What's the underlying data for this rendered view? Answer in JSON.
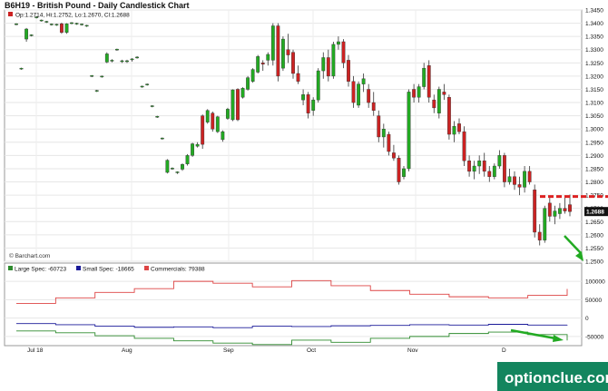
{
  "header": {
    "title": "B6H19 - British Pound - Daily Candlestick Chart"
  },
  "watermark": "optionclue.com",
  "chart_data": [
    {
      "type": "candlestick",
      "title": "B6H19 - British Pound - Daily Candlestick Chart",
      "ohlc_label": "Op:1.2714, Hi:1.2752, Lo:1.2670, Cl:1.2688",
      "last_price_label": "1.2688",
      "source": "© Barchart.com",
      "ylim": [
        1.25,
        1.345
      ],
      "y_ticks": [
        1.25,
        1.255,
        1.26,
        1.265,
        1.27,
        1.275,
        1.28,
        1.285,
        1.29,
        1.295,
        1.3,
        1.305,
        1.31,
        1.315,
        1.32,
        1.325,
        1.33,
        1.335,
        1.34,
        1.345
      ],
      "x_ticks": [
        "Jul 18",
        "Aug",
        "Sep",
        "Oct",
        "Nov",
        "D"
      ],
      "reference_level": 1.2745,
      "colors": {
        "up": "#22aa22",
        "down": "#cc2222",
        "reference": "#dd2222",
        "arrow": "#22aa22"
      },
      "candles": [
        {
          "o": 1.3396,
          "h": 1.34,
          "l": 1.3392,
          "c": 1.3398
        },
        {
          "o": 1.3228,
          "h": 1.3232,
          "l": 1.3224,
          "c": 1.323
        },
        {
          "o": 1.334,
          "h": 1.3382,
          "l": 1.333,
          "c": 1.3378
        },
        {
          "o": 1.3354,
          "h": 1.3358,
          "l": 1.335,
          "c": 1.3356
        },
        {
          "o": 1.3422,
          "h": 1.3426,
          "l": 1.3418,
          "c": 1.3424
        },
        {
          "o": 1.341,
          "h": 1.3414,
          "l": 1.3406,
          "c": 1.3412
        },
        {
          "o": 1.3405,
          "h": 1.3409,
          "l": 1.3401,
          "c": 1.3407
        },
        {
          "o": 1.3395,
          "h": 1.3399,
          "l": 1.3391,
          "c": 1.3397
        },
        {
          "o": 1.3394,
          "h": 1.3398,
          "l": 1.339,
          "c": 1.3396
        },
        {
          "o": 1.3398,
          "h": 1.3402,
          "l": 1.336,
          "c": 1.3365
        },
        {
          "o": 1.3365,
          "h": 1.34,
          "l": 1.336,
          "c": 1.3398
        },
        {
          "o": 1.34,
          "h": 1.3404,
          "l": 1.3396,
          "c": 1.3402
        },
        {
          "o": 1.3398,
          "h": 1.3402,
          "l": 1.3394,
          "c": 1.34
        },
        {
          "o": 1.3395,
          "h": 1.3399,
          "l": 1.3391,
          "c": 1.3397
        },
        {
          "o": 1.339,
          "h": 1.3394,
          "l": 1.3386,
          "c": 1.3392
        },
        {
          "o": 1.32,
          "h": 1.3204,
          "l": 1.3196,
          "c": 1.3202
        },
        {
          "o": 1.3144,
          "h": 1.3148,
          "l": 1.314,
          "c": 1.3146
        },
        {
          "o": 1.3198,
          "h": 1.3202,
          "l": 1.3194,
          "c": 1.32
        },
        {
          "o": 1.3253,
          "h": 1.329,
          "l": 1.3249,
          "c": 1.3284
        },
        {
          "o": 1.3258,
          "h": 1.3264,
          "l": 1.3252,
          "c": 1.326
        },
        {
          "o": 1.33,
          "h": 1.3304,
          "l": 1.3296,
          "c": 1.3302
        },
        {
          "o": 1.3255,
          "h": 1.3262,
          "l": 1.325,
          "c": 1.3258
        },
        {
          "o": 1.3255,
          "h": 1.3262,
          "l": 1.325,
          "c": 1.3258
        },
        {
          "o": 1.3262,
          "h": 1.3268,
          "l": 1.3255,
          "c": 1.3265
        },
        {
          "o": 1.327,
          "h": 1.3275,
          "l": 1.3266,
          "c": 1.3272
        },
        {
          "o": 1.316,
          "h": 1.3164,
          "l": 1.3156,
          "c": 1.3162
        },
        {
          "o": 1.3168,
          "h": 1.3172,
          "l": 1.3164,
          "c": 1.317
        },
        {
          "o": 1.3086,
          "h": 1.309,
          "l": 1.3082,
          "c": 1.3088
        },
        {
          "o": 1.3046,
          "h": 1.305,
          "l": 1.3042,
          "c": 1.3048
        },
        {
          "o": 1.2964,
          "h": 1.2968,
          "l": 1.296,
          "c": 1.2966
        },
        {
          "o": 1.2836,
          "h": 1.2886,
          "l": 1.2832,
          "c": 1.2882
        },
        {
          "o": 1.285,
          "h": 1.2855,
          "l": 1.2846,
          "c": 1.2852
        },
        {
          "o": 1.2835,
          "h": 1.284,
          "l": 1.283,
          "c": 1.2838
        },
        {
          "o": 1.2848,
          "h": 1.287,
          "l": 1.2842,
          "c": 1.2866
        },
        {
          "o": 1.2868,
          "h": 1.2905,
          "l": 1.2862,
          "c": 1.29
        },
        {
          "o": 1.29,
          "h": 1.2948,
          "l": 1.2895,
          "c": 1.2944
        },
        {
          "o": 1.2935,
          "h": 1.295,
          "l": 1.293,
          "c": 1.2942
        },
        {
          "o": 1.305,
          "h": 1.3055,
          "l": 1.2925,
          "c": 1.2942
        },
        {
          "o": 1.3026,
          "h": 1.3075,
          "l": 1.302,
          "c": 1.307
        },
        {
          "o": 1.306,
          "h": 1.3066,
          "l": 1.299,
          "c": 1.3
        },
        {
          "o": 1.299,
          "h": 1.305,
          "l": 1.2985,
          "c": 1.3046
        },
        {
          "o": 1.296,
          "h": 1.2995,
          "l": 1.2952,
          "c": 1.299
        },
        {
          "o": 1.304,
          "h": 1.308,
          "l": 1.3035,
          "c": 1.3075
        },
        {
          "o": 1.3035,
          "h": 1.315,
          "l": 1.303,
          "c": 1.3148
        },
        {
          "o": 1.315,
          "h": 1.3154,
          "l": 1.303,
          "c": 1.3035
        },
        {
          "o": 1.312,
          "h": 1.3158,
          "l": 1.3115,
          "c": 1.3154
        },
        {
          "o": 1.315,
          "h": 1.32,
          "l": 1.3145,
          "c": 1.3194
        },
        {
          "o": 1.318,
          "h": 1.323,
          "l": 1.3175,
          "c": 1.3225
        },
        {
          "o": 1.3215,
          "h": 1.328,
          "l": 1.321,
          "c": 1.3274
        },
        {
          "o": 1.325,
          "h": 1.326,
          "l": 1.322,
          "c": 1.3245
        },
        {
          "o": 1.326,
          "h": 1.329,
          "l": 1.324,
          "c": 1.3282
        },
        {
          "o": 1.326,
          "h": 1.34,
          "l": 1.324,
          "c": 1.339
        },
        {
          "o": 1.339,
          "h": 1.34,
          "l": 1.318,
          "c": 1.32
        },
        {
          "o": 1.323,
          "h": 1.335,
          "l": 1.322,
          "c": 1.334
        },
        {
          "o": 1.33,
          "h": 1.336,
          "l": 1.325,
          "c": 1.328
        },
        {
          "o": 1.329,
          "h": 1.33,
          "l": 1.319,
          "c": 1.321
        },
        {
          "o": 1.321,
          "h": 1.324,
          "l": 1.317,
          "c": 1.318
        },
        {
          "o": 1.311,
          "h": 1.315,
          "l": 1.309,
          "c": 1.313
        },
        {
          "o": 1.313,
          "h": 1.314,
          "l": 1.304,
          "c": 1.306
        },
        {
          "o": 1.307,
          "h": 1.312,
          "l": 1.305,
          "c": 1.311
        },
        {
          "o": 1.311,
          "h": 1.323,
          "l": 1.31,
          "c": 1.322
        },
        {
          "o": 1.322,
          "h": 1.329,
          "l": 1.319,
          "c": 1.327
        },
        {
          "o": 1.327,
          "h": 1.33,
          "l": 1.318,
          "c": 1.32
        },
        {
          "o": 1.32,
          "h": 1.333,
          "l": 1.319,
          "c": 1.332
        },
        {
          "o": 1.332,
          "h": 1.335,
          "l": 1.33,
          "c": 1.333
        },
        {
          "o": 1.333,
          "h": 1.334,
          "l": 1.323,
          "c": 1.325
        },
        {
          "o": 1.326,
          "h": 1.328,
          "l": 1.316,
          "c": 1.318
        },
        {
          "o": 1.318,
          "h": 1.32,
          "l": 1.308,
          "c": 1.31
        },
        {
          "o": 1.309,
          "h": 1.318,
          "l": 1.308,
          "c": 1.317
        },
        {
          "o": 1.317,
          "h": 1.321,
          "l": 1.314,
          "c": 1.319
        },
        {
          "o": 1.315,
          "h": 1.317,
          "l": 1.308,
          "c": 1.31
        },
        {
          "o": 1.31,
          "h": 1.314,
          "l": 1.305,
          "c": 1.307
        },
        {
          "o": 1.305,
          "h": 1.307,
          "l": 1.295,
          "c": 1.297
        },
        {
          "o": 1.297,
          "h": 1.302,
          "l": 1.293,
          "c": 1.3
        },
        {
          "o": 1.298,
          "h": 1.299,
          "l": 1.29,
          "c": 1.2915
        },
        {
          "o": 1.291,
          "h": 1.294,
          "l": 1.288,
          "c": 1.289
        },
        {
          "o": 1.289,
          "h": 1.29,
          "l": 1.279,
          "c": 1.28
        },
        {
          "o": 1.282,
          "h": 1.286,
          "l": 1.281,
          "c": 1.285
        },
        {
          "o": 1.285,
          "h": 1.315,
          "l": 1.284,
          "c": 1.314
        },
        {
          "o": 1.315,
          "h": 1.317,
          "l": 1.31,
          "c": 1.312
        },
        {
          "o": 1.312,
          "h": 1.317,
          "l": 1.31,
          "c": 1.316
        },
        {
          "o": 1.316,
          "h": 1.325,
          "l": 1.315,
          "c": 1.323
        },
        {
          "o": 1.324,
          "h": 1.326,
          "l": 1.31,
          "c": 1.312
        },
        {
          "o": 1.311,
          "h": 1.313,
          "l": 1.306,
          "c": 1.308
        },
        {
          "o": 1.306,
          "h": 1.316,
          "l": 1.304,
          "c": 1.315
        },
        {
          "o": 1.314,
          "h": 1.317,
          "l": 1.311,
          "c": 1.313
        },
        {
          "o": 1.312,
          "h": 1.313,
          "l": 1.296,
          "c": 1.298
        },
        {
          "o": 1.298,
          "h": 1.303,
          "l": 1.295,
          "c": 1.301
        },
        {
          "o": 1.302,
          "h": 1.304,
          "l": 1.298,
          "c": 1.299
        },
        {
          "o": 1.299,
          "h": 1.301,
          "l": 1.286,
          "c": 1.288
        },
        {
          "o": 1.288,
          "h": 1.29,
          "l": 1.282,
          "c": 1.284
        },
        {
          "o": 1.284,
          "h": 1.288,
          "l": 1.281,
          "c": 1.286
        },
        {
          "o": 1.286,
          "h": 1.29,
          "l": 1.283,
          "c": 1.288
        },
        {
          "o": 1.288,
          "h": 1.291,
          "l": 1.282,
          "c": 1.284
        },
        {
          "o": 1.284,
          "h": 1.286,
          "l": 1.28,
          "c": 1.282
        },
        {
          "o": 1.282,
          "h": 1.287,
          "l": 1.281,
          "c": 1.286
        },
        {
          "o": 1.286,
          "h": 1.292,
          "l": 1.285,
          "c": 1.29
        },
        {
          "o": 1.29,
          "h": 1.291,
          "l": 1.278,
          "c": 1.28
        },
        {
          "o": 1.28,
          "h": 1.285,
          "l": 1.279,
          "c": 1.282
        },
        {
          "o": 1.282,
          "h": 1.284,
          "l": 1.277,
          "c": 1.279
        },
        {
          "o": 1.279,
          "h": 1.282,
          "l": 1.275,
          "c": 1.278
        },
        {
          "o": 1.278,
          "h": 1.286,
          "l": 1.276,
          "c": 1.284
        },
        {
          "o": 1.284,
          "h": 1.286,
          "l": 1.279,
          "c": 1.28
        },
        {
          "o": 1.277,
          "h": 1.279,
          "l": 1.259,
          "c": 1.261
        },
        {
          "o": 1.261,
          "h": 1.264,
          "l": 1.256,
          "c": 1.258
        },
        {
          "o": 1.258,
          "h": 1.271,
          "l": 1.257,
          "c": 1.27
        },
        {
          "o": 1.272,
          "h": 1.274,
          "l": 1.265,
          "c": 1.267
        },
        {
          "o": 1.267,
          "h": 1.271,
          "l": 1.264,
          "c": 1.269
        },
        {
          "o": 1.268,
          "h": 1.272,
          "l": 1.266,
          "c": 1.27
        },
        {
          "o": 1.27,
          "h": 1.274,
          "l": 1.268,
          "c": 1.269
        },
        {
          "o": 1.2714,
          "h": 1.2752,
          "l": 1.267,
          "c": 1.2688
        }
      ]
    },
    {
      "type": "line",
      "title": "",
      "x_ticks": [
        "Jul 18",
        "Aug",
        "Sep",
        "Oct",
        "Nov",
        "D"
      ],
      "ylim": [
        -75000,
        125000
      ],
      "y_ticks": [
        100000,
        50000,
        0,
        -50000
      ],
      "y_tick_labels": [
        "100000",
        "50000",
        "0",
        "-50000"
      ],
      "series": [
        {
          "name": "Large Spec",
          "legend_label": "Large Spec: -60723",
          "color": "#2e8b2e",
          "values": [
            -35000,
            -35000,
            -40000,
            -40000,
            -48000,
            -48000,
            -55000,
            -55000,
            -62000,
            -62000,
            -68000,
            -68000,
            -72000,
            -72000,
            -60000,
            -60000,
            -66000,
            -66000,
            -55000,
            -55000,
            -50000,
            -50000,
            -42000,
            -42000,
            -38000,
            -38000,
            -45000,
            -45000,
            -60723
          ]
        },
        {
          "name": "Small Spec",
          "legend_label": "Small Spec: -18665",
          "color": "#1a1a99",
          "values": [
            -15000,
            -15000,
            -18000,
            -18000,
            -22000,
            -22000,
            -25000,
            -25000,
            -24000,
            -24000,
            -26000,
            -26000,
            -22000,
            -22000,
            -23000,
            -23000,
            -21000,
            -21000,
            -20000,
            -20000,
            -18000,
            -18000,
            -19000,
            -19000,
            -17000,
            -17000,
            -19000,
            -19000,
            -18665
          ]
        },
        {
          "name": "Commercials",
          "legend_label": "Commercials: 79388",
          "color": "#dd4444",
          "values": [
            40000,
            40000,
            55000,
            55000,
            70000,
            70000,
            80000,
            80000,
            100000,
            100000,
            95000,
            95000,
            85000,
            85000,
            102000,
            102000,
            88000,
            88000,
            75000,
            75000,
            65000,
            65000,
            58000,
            58000,
            55000,
            55000,
            62000,
            62000,
            79388
          ]
        }
      ]
    }
  ]
}
